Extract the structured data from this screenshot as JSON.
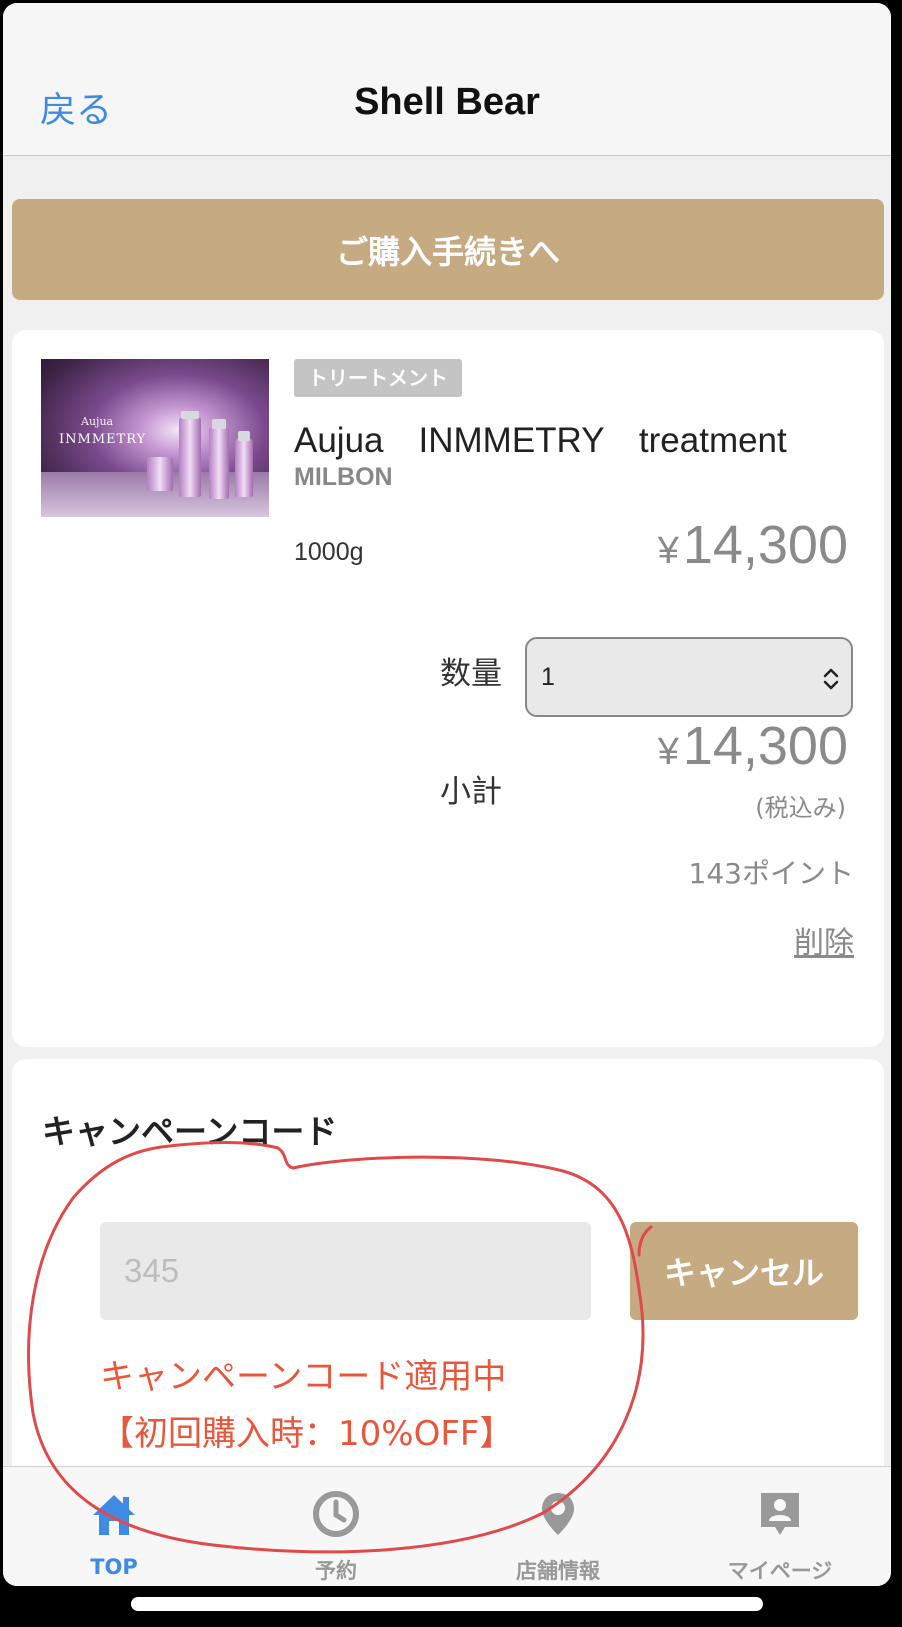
{
  "navbar": {
    "back_label": "戻る",
    "title": "Shell Bear"
  },
  "checkout_label": "ご購入手続きへ",
  "product": {
    "image_text_1": "Aujua",
    "image_text_2": "INMMETRY",
    "category": "トリートメント",
    "name": "Aujua　INMMETRY　treatment",
    "brand": "MILBON",
    "size": "1000g",
    "currency": "¥",
    "price": "14,300",
    "quantity_label": "数量",
    "quantity_value": "1",
    "subtotal_label": "小計",
    "subtotal": "14,300",
    "tax_note": "(税込み)",
    "points": "143ポイント",
    "delete_label": "削除"
  },
  "campaign": {
    "title": "キャンペーンコード",
    "code_value": "345",
    "cancel_label": "キャンセル",
    "status_line1": "キャンペーンコード適用中",
    "status_line2": "【初回購入時：10%OFF】"
  },
  "tabbar": {
    "items": [
      {
        "label": "TOP",
        "icon": "home-icon",
        "active": true
      },
      {
        "label": "予約",
        "icon": "clock-icon",
        "active": false
      },
      {
        "label": "店舗情報",
        "icon": "map-pin-icon",
        "active": false
      },
      {
        "label": "マイページ",
        "icon": "profile-icon",
        "active": false
      }
    ]
  },
  "colors": {
    "accent_gold": "#c5aa82",
    "link_blue": "#3f8be4",
    "status_red": "#e8573c",
    "annotation_red": "#e04a4a"
  }
}
